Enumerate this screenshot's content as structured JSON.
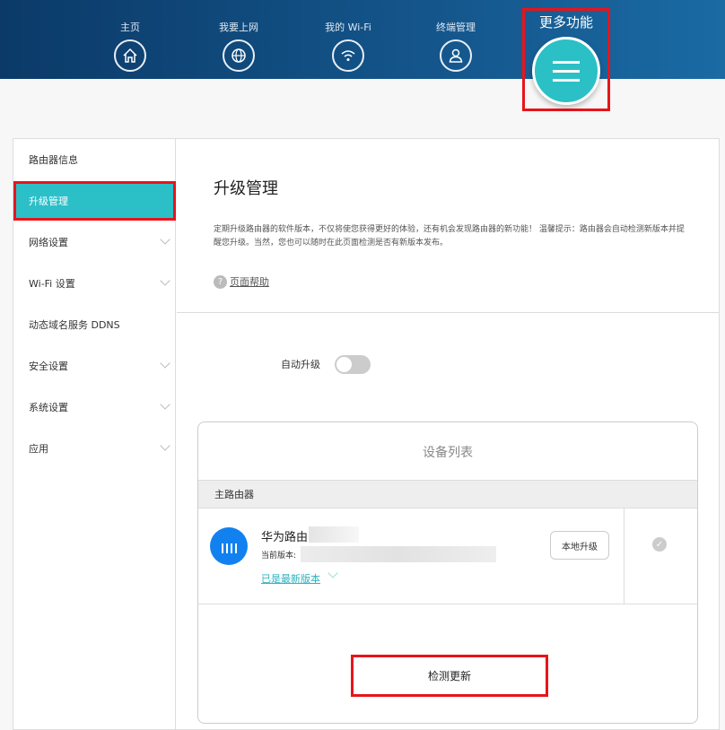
{
  "nav": {
    "items": [
      {
        "label": "主页",
        "icon": "home-icon"
      },
      {
        "label": "我要上网",
        "icon": "globe-icon"
      },
      {
        "label": "我的 Wi-Fi",
        "icon": "wifi-icon"
      },
      {
        "label": "终端管理",
        "icon": "user-icon"
      }
    ],
    "more_label": "更多功能"
  },
  "sidebar": {
    "items": [
      {
        "label": "路由器信息"
      },
      {
        "label": "升级管理"
      },
      {
        "label": "网络设置"
      },
      {
        "label": "Wi-Fi 设置"
      },
      {
        "label": "动态域名服务 DDNS"
      },
      {
        "label": "安全设置"
      },
      {
        "label": "系统设置"
      },
      {
        "label": "应用"
      }
    ]
  },
  "main": {
    "title": "升级管理",
    "description": "定期升级路由器的软件版本，不仅将使您获得更好的体验，还有机会发现路由器的新功能！ 温馨提示：路由器会自动检测新版本并提醒您升级。当然，您也可以随时在此页面检测是否有新版本发布。",
    "help_link": "页面帮助",
    "help_icon": "?",
    "auto_upgrade_label": "自动升级",
    "auto_upgrade_on": false,
    "device_list": {
      "title": "设备列表",
      "group": "主路由器",
      "device_name": "华为路由",
      "current_version_label": "当前版本:",
      "status_link": "已是最新版本",
      "local_upgrade_button": "本地升级",
      "check_mark": "✓"
    },
    "detect_button": "检测更新"
  },
  "colors": {
    "accent": "#2bbfc8",
    "highlight": "#e8141b",
    "header": "#0b3a68"
  }
}
